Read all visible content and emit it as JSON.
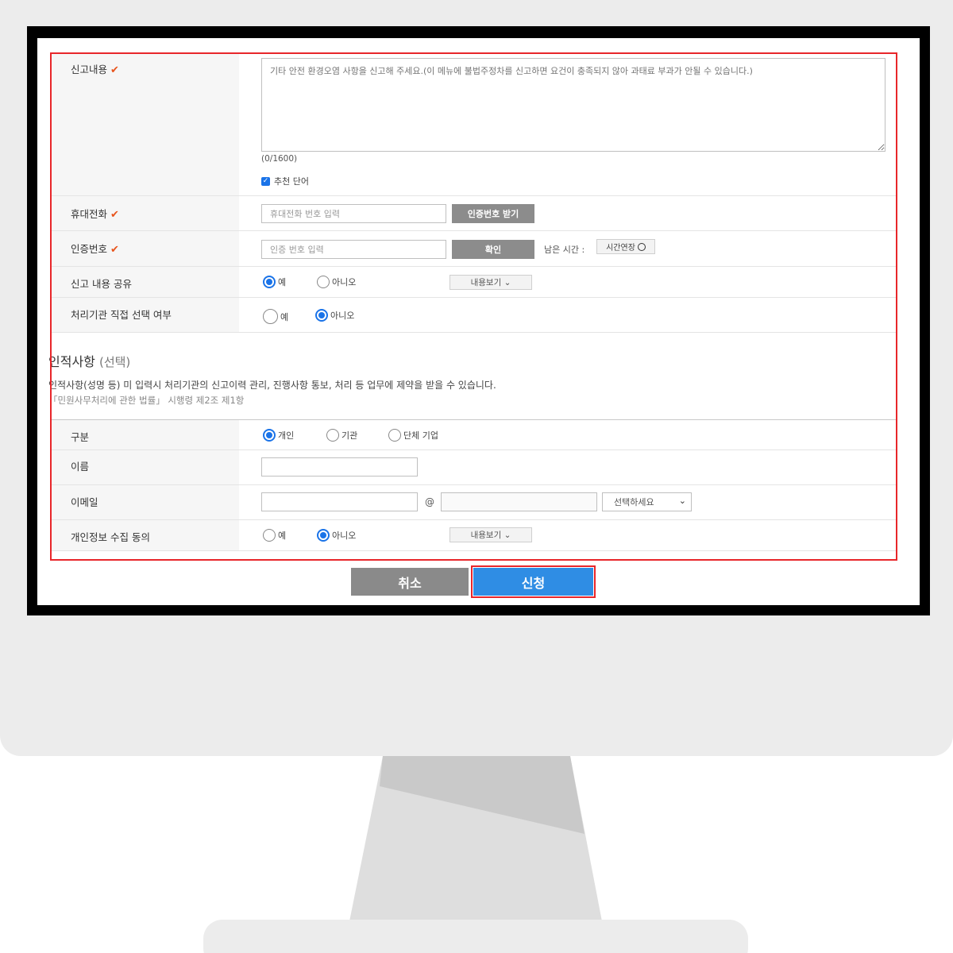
{
  "report": {
    "content_label": "신고내용",
    "content_placeholder": "기타 안전 환경오염 사항을 신고해 주세요.(이 메뉴에 불법주정차를 신고하면 요건이 충족되지 않아 과태료 부과가 안될 수 있습니다.)",
    "char_count": "(0/1600)",
    "recommend_checkbox_label": "추천 단어",
    "recommend_checked": true
  },
  "phone": {
    "label": "휴대전화",
    "placeholder": "휴대전화 번호 입력",
    "button_label": "인증번호 받기"
  },
  "verify": {
    "label": "인증번호",
    "placeholder": "인증 번호 입력",
    "button_label": "확인",
    "remaining_label": "남은 시간 :",
    "extend_label": "시간연장"
  },
  "share": {
    "label": "신고 내용 공유",
    "yes": "예",
    "no": "아니오",
    "selected": "yes",
    "view_label": "내용보기 ⌄"
  },
  "agency_select": {
    "label": "처리기관 직접 선택 여부",
    "yes": "예",
    "no": "아니오",
    "selected": "no"
  },
  "personal": {
    "title": "인적사항",
    "title_suffix": "(선택)",
    "notice": "인적사항(성명 등) 미 입력시 처리기관의 신고이력 관리, 진행사항 통보, 처리 등 업무에 제약을 받을 수 있습니다.",
    "law": "「민원사무처리에 관한 법률」 시행령 제2조 제1항"
  },
  "category": {
    "label": "구분",
    "options": [
      "개인",
      "기관",
      "단체 기업"
    ],
    "selected": "개인"
  },
  "name": {
    "label": "이름",
    "value": ""
  },
  "email": {
    "label": "이메일",
    "at": "@",
    "local_value": "",
    "domain_value": "",
    "select_label": "선택하세요"
  },
  "consent": {
    "label": "개인정보 수집 동의",
    "yes": "예",
    "no": "아니오",
    "selected": "no",
    "view_label": "내용보기 ⌄"
  },
  "actions": {
    "cancel_label": "취소",
    "submit_label": "신청"
  },
  "colors": {
    "accent": "#2f8de4",
    "highlight": "#e8262a",
    "required_check": "#e8541c"
  }
}
